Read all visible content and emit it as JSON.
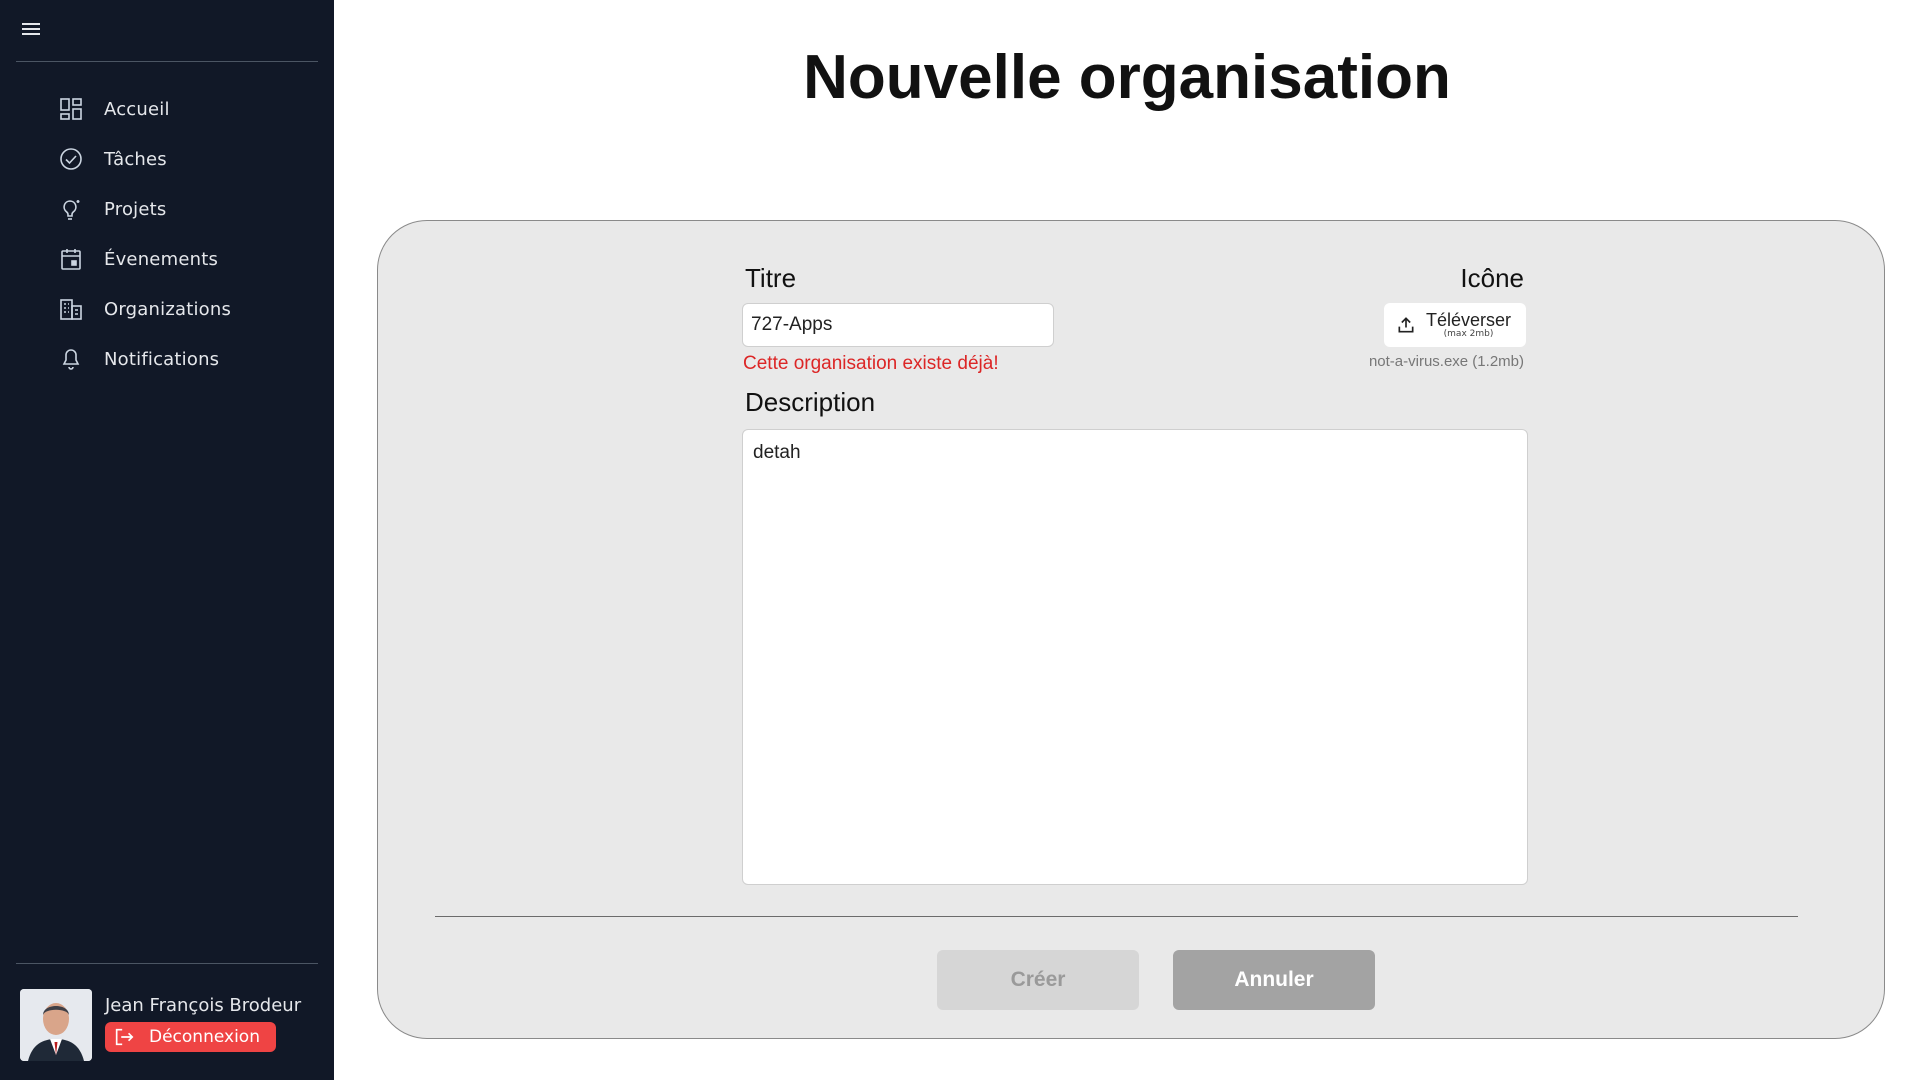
{
  "sidebar": {
    "menu_icon": "hamburger-icon",
    "items": [
      {
        "label": "Accueil",
        "icon": "dashboard-grid-icon"
      },
      {
        "label": "Tâches",
        "icon": "check-circle-icon"
      },
      {
        "label": "Projets",
        "icon": "lightbulb-icon"
      },
      {
        "label": "Évenements",
        "icon": "calendar-icon"
      },
      {
        "label": "Organizations",
        "icon": "building-icon"
      },
      {
        "label": "Notifications",
        "icon": "bell-icon"
      }
    ],
    "user": {
      "name": "Jean François Brodeur",
      "logout_label": "Déconnexion",
      "logout_icon": "logout-icon"
    }
  },
  "main": {
    "page_title": "Nouvelle organisation",
    "form": {
      "title_label": "Titre",
      "title_value": "727-Apps",
      "title_error": "Cette organisation existe déjà!",
      "icon_label": "Icône",
      "upload_label": "Téléverser",
      "upload_sublabel": "(max 2mb)",
      "upload_icon": "upload-icon",
      "uploaded_file": "not-a-virus.exe (1.2mb)",
      "description_label": "Description",
      "description_value": "detah",
      "create_label": "Créer",
      "cancel_label": "Annuler"
    }
  },
  "colors": {
    "sidebar_bg": "#111827",
    "error": "#dc2626",
    "logout_bg": "#ef4444",
    "card_bg": "#e9e9e9"
  }
}
